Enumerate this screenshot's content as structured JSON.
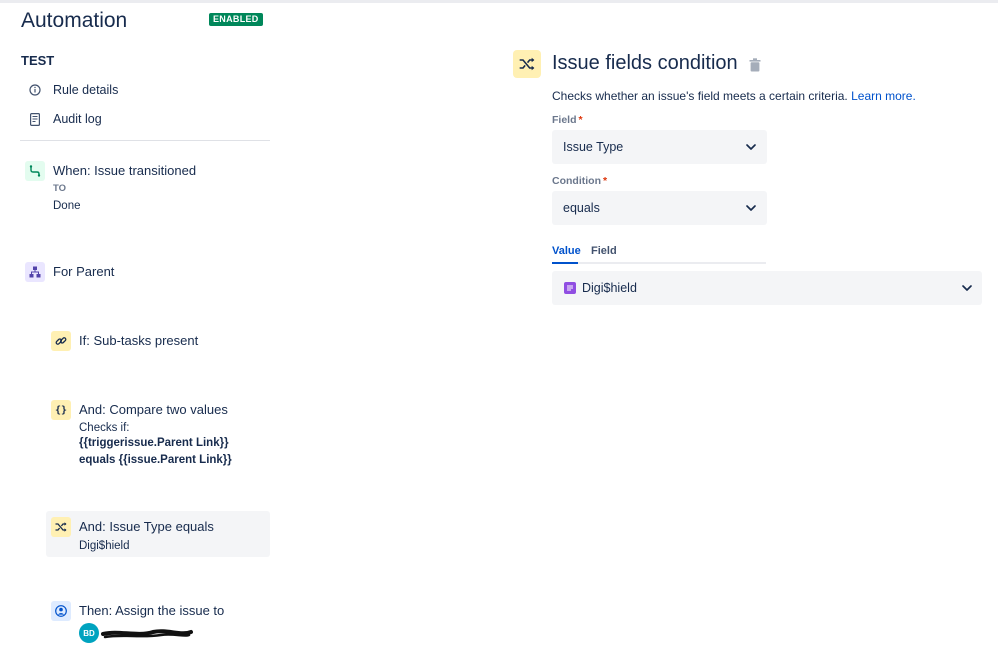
{
  "header": {
    "app_title": "Automation",
    "status_badge": "ENABLED"
  },
  "rule": {
    "name": "TEST",
    "nav": [
      {
        "label": "Rule details",
        "icon": "info-icon"
      },
      {
        "label": "Audit log",
        "icon": "document-icon"
      }
    ]
  },
  "steps": {
    "trigger": {
      "title": "When: Issue transitioned",
      "sub_label": "TO",
      "sub_value": "Done",
      "icon": "transition-icon"
    },
    "branch": {
      "title": "For Parent",
      "icon": "hierarchy-icon"
    },
    "condition1": {
      "title": "If: Sub-tasks present",
      "icon": "link-icon"
    },
    "condition2": {
      "title": "And: Compare two values",
      "line1": "Checks if:",
      "line2": "{{triggerissue.Parent Link}}",
      "line3": "equals {{issue.Parent Link}}",
      "icon": "braces-icon"
    },
    "condition3": {
      "title": "And: Issue Type equals",
      "sub": "Digi$hield",
      "icon": "shuffle-icon"
    },
    "action": {
      "title": "Then: Assign the issue to",
      "avatar_initials": "BD",
      "icon": "user-icon"
    }
  },
  "panel": {
    "title": "Issue fields condition",
    "description": "Checks whether an issue's field meets a certain criteria.",
    "learn_more": "Learn more.",
    "field_label": "Field",
    "field_value": "Issue Type",
    "condition_label": "Condition",
    "condition_value": "equals",
    "tabs": [
      "Value",
      "Field"
    ],
    "value_selected": "Digi$hield"
  },
  "colors": {
    "accent": "#0052cc",
    "badge": "#00875a",
    "required": "#de350b"
  }
}
